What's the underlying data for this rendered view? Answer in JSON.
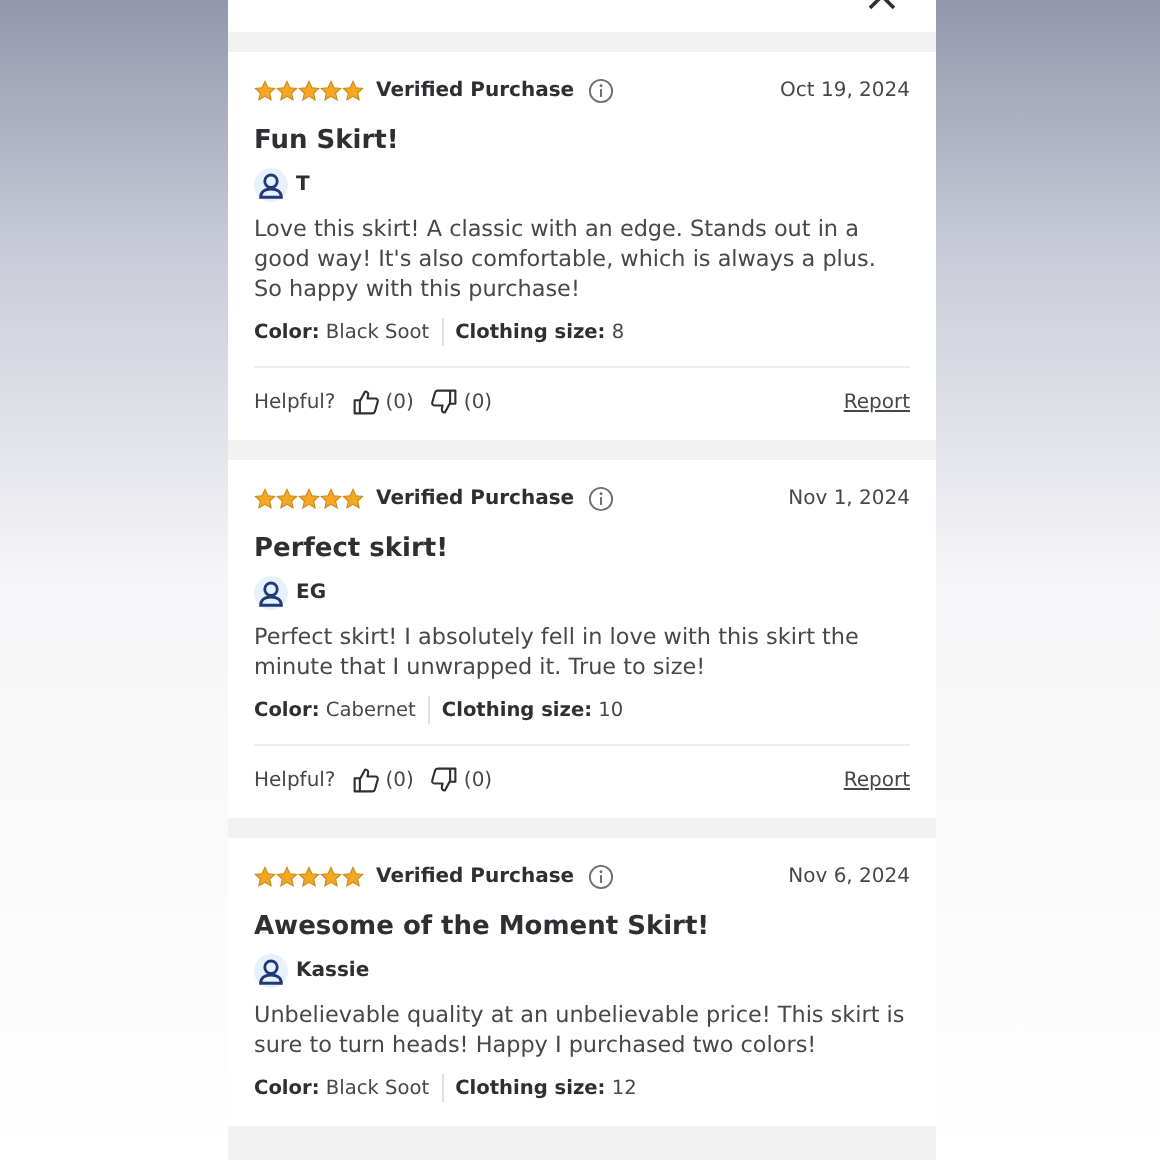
{
  "reviews": [
    {
      "stars": 5,
      "badge": "Verified Purchase",
      "date": "Oct 19, 2024",
      "title": "Fun Skirt!",
      "author": "T",
      "text": "Love this skirt! A classic with an edge. Stands out in a good way! It's also comfortable, which is always a plus. So happy with this purchase!",
      "attributes": [
        {
          "label": "Color:",
          "value": "Black Soot"
        },
        {
          "label": "Clothing size:",
          "value": "8"
        }
      ],
      "helpful_label": "Helpful?",
      "up_count": "(0)",
      "down_count": "(0)",
      "report": "Report"
    },
    {
      "stars": 5,
      "badge": "Verified Purchase",
      "date": "Nov 1, 2024",
      "title": "Perfect skirt!",
      "author": "EG",
      "text": "Perfect skirt! I absolutely fell in love with this skirt the minute that I unwrapped it. True to size!",
      "attributes": [
        {
          "label": "Color:",
          "value": "Cabernet"
        },
        {
          "label": "Clothing size:",
          "value": "10"
        }
      ],
      "helpful_label": "Helpful?",
      "up_count": "(0)",
      "down_count": "(0)",
      "report": "Report"
    },
    {
      "stars": 5,
      "badge": "Verified Purchase",
      "date": "Nov 6, 2024",
      "title": "Awesome of the Moment Skirt!",
      "author": "Kassie",
      "text": "Unbelievable quality at an unbelievable price! This skirt is sure to turn heads! Happy I purchased two colors!",
      "attributes": [
        {
          "label": "Color:",
          "value": "Black Soot"
        },
        {
          "label": "Clothing size:",
          "value": "12"
        }
      ]
    }
  ]
}
